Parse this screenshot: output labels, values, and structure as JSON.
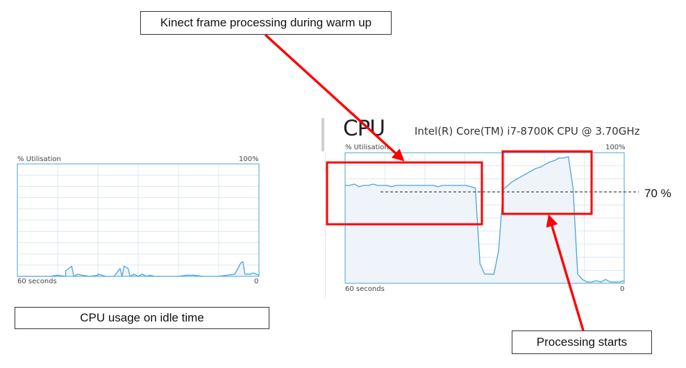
{
  "callouts": {
    "kinect": "Kinect frame processing during warm up",
    "idle": "CPU usage on idle time",
    "processing": "Processing starts",
    "level": "70 %"
  },
  "cpu_panel": {
    "title": "CPU",
    "model": "Intel(R) Core(TM) i7-8700K CPU @ 3.70GHz"
  },
  "colors": {
    "line": "#4aa3d8",
    "fill": "#eef4f9",
    "grid": "#dbe7f0",
    "border": "#4aa3d8",
    "annotation": "#ff0000"
  },
  "chart_data": [
    {
      "type": "area",
      "ylabel": "% Utilisation",
      "ymax_label": "100%",
      "xlabel_left": "60 seconds",
      "xlabel_right": "0",
      "ylim": [
        0,
        100
      ],
      "xlim": [
        60,
        0
      ],
      "x": [
        60,
        58,
        56,
        54,
        52,
        50,
        48,
        46,
        44,
        42,
        40,
        38,
        36,
        34,
        32,
        30,
        28,
        26,
        24,
        22,
        20,
        18,
        16,
        14,
        12,
        10,
        8,
        6,
        4,
        2,
        0
      ],
      "values": [
        0,
        0,
        0,
        0,
        0,
        1,
        0,
        0,
        1,
        0,
        1,
        0,
        0,
        0,
        0,
        0,
        0,
        0,
        0,
        0,
        0,
        1,
        1,
        0,
        0,
        0,
        1,
        2,
        13,
        2,
        1
      ],
      "extra_points": [
        [
          48,
          5
        ],
        [
          46.5,
          9
        ],
        [
          45,
          2
        ],
        [
          40,
          2
        ],
        [
          39,
          1
        ],
        [
          34.5,
          7
        ],
        [
          33.5,
          9
        ],
        [
          32.5,
          7
        ],
        [
          31,
          2
        ],
        [
          29,
          2
        ],
        [
          27,
          1
        ],
        [
          4.5,
          12
        ],
        [
          3.5,
          2
        ],
        [
          1.5,
          3
        ]
      ]
    },
    {
      "type": "area",
      "title": "CPU",
      "ylabel": "% Utilisation",
      "ymax_label": "100%",
      "xlabel_left": "60 seconds",
      "xlabel_right": "0",
      "ylim": [
        0,
        100
      ],
      "xlim": [
        60,
        0
      ],
      "x": [
        60,
        59,
        58,
        57,
        56,
        55,
        54,
        53,
        52,
        51,
        50,
        49,
        48,
        47,
        46,
        45,
        44,
        43,
        42,
        41,
        40,
        39,
        38,
        37,
        36,
        35,
        34,
        33,
        32,
        31,
        30,
        29,
        28,
        27,
        26,
        25,
        24,
        23,
        22,
        21,
        20,
        19,
        18,
        17,
        16,
        15,
        14,
        13,
        12,
        11,
        10,
        9,
        8,
        7,
        6,
        5,
        4,
        3,
        2,
        1,
        0
      ],
      "values": [
        75,
        75,
        76,
        74,
        75,
        75,
        76,
        75,
        75,
        75,
        74,
        75,
        75,
        75,
        75,
        75,
        75,
        75,
        75,
        75,
        74,
        75,
        75,
        75,
        75,
        75,
        75,
        74,
        73,
        15,
        7,
        7,
        7,
        25,
        72,
        75,
        78,
        80,
        82,
        84,
        86,
        88,
        89,
        91,
        93,
        94,
        96,
        96,
        97,
        73,
        7,
        3,
        1,
        1,
        2,
        1,
        3,
        1,
        1,
        1,
        2
      ],
      "reference_line": 70
    }
  ]
}
